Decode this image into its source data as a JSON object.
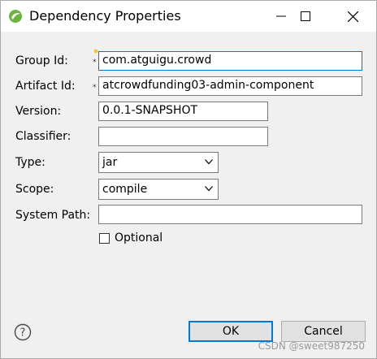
{
  "window": {
    "title": "Dependency Properties"
  },
  "form": {
    "group_id": {
      "label": "Group Id:",
      "value": "com.atguigu.crowd"
    },
    "artifact_id": {
      "label": "Artifact Id:",
      "value": "atcrowdfunding03-admin-component"
    },
    "version": {
      "label": "Version:",
      "value": "0.0.1-SNAPSHOT"
    },
    "classifier": {
      "label": "Classifier:",
      "value": ""
    },
    "type": {
      "label": "Type:",
      "value": "jar"
    },
    "scope": {
      "label": "Scope:",
      "value": "compile"
    },
    "system_path": {
      "label": "System Path:",
      "value": ""
    },
    "optional": {
      "label": "Optional",
      "checked": false
    },
    "required_marker": "*"
  },
  "buttons": {
    "ok": "OK",
    "cancel": "Cancel"
  },
  "watermark": "CSDN @sweet987250",
  "icons": {
    "app": "eclipse-icon",
    "minimize": "minimize-icon",
    "maximize": "maximize-icon",
    "close": "close-icon",
    "help": "help-icon",
    "dropdown": "chevron-down-icon",
    "info_decorator": "info-icon"
  },
  "colors": {
    "focus": "#0078d7",
    "background": "#f0f0f0"
  }
}
